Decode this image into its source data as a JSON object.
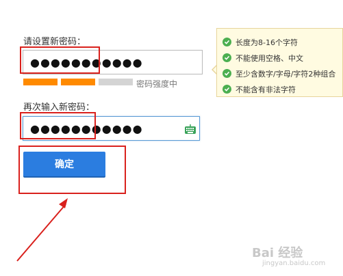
{
  "form": {
    "new_password_label": "请设置新密码：",
    "new_password_value": "●●●●●●●●●●●",
    "strength_label": "密码强度中",
    "confirm_password_label": "再次输入新密码：",
    "confirm_password_value": "●●●●●●●●●●●",
    "confirm_button": "确定"
  },
  "strength": {
    "level": "medium",
    "segments": 3,
    "active_segments": 2,
    "active_color": "#ff8a00",
    "inactive_color": "#d4d4d4"
  },
  "tips": [
    "长度为8-16个字符",
    "不能使用空格、中文",
    "至少含数字/字母/字符2种组合",
    "不能含有非法字符"
  ],
  "colors": {
    "button": "#2b7de0",
    "highlight_frame": "#d9201c",
    "check": "#4caf50",
    "tip_background": "#fffbe1"
  },
  "icons": {
    "keyboard": "keyboard-icon",
    "tip_check": "check-circle-icon"
  },
  "watermark": {
    "text": "Bai 经验",
    "url": "jingyan.baidu.com"
  }
}
